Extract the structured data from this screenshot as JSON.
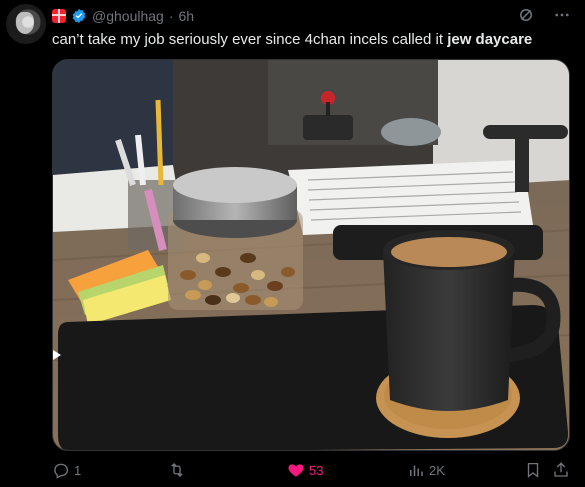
{
  "post": {
    "handle": "@ghoulhag",
    "separator": "·",
    "time": "6h",
    "text_before": "can’t take my job seriously ever since 4chan incels called it ",
    "text_bold": "jew daycare",
    "avatar_icon": "avatar-image",
    "badges": [
      "gift-icon",
      "verified-icon"
    ]
  },
  "actions": {
    "replies": "1",
    "reposts": "",
    "likes": "53",
    "views": "2K",
    "like_color": "#f91880",
    "muted_color": "#71767b"
  },
  "colors": {
    "background": "#000000",
    "text": "#e7e9ea",
    "verified": "#1d9bf0"
  }
}
